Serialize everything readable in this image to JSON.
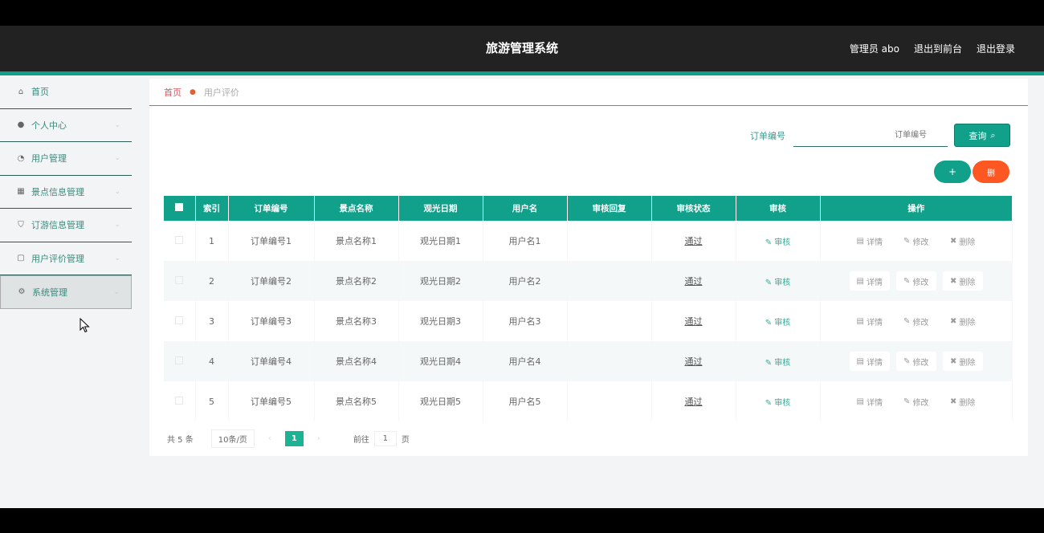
{
  "header": {
    "title": "旅游管理系统",
    "admin": "管理员 abo",
    "to_front": "退出到前台",
    "logout": "退出登录"
  },
  "sidebar": {
    "items": [
      {
        "label": "首页",
        "icon": "home-icon"
      },
      {
        "label": "个人中心",
        "icon": "user-icon"
      },
      {
        "label": "用户管理",
        "icon": "users-icon"
      },
      {
        "label": "景点信息管理",
        "icon": "image-icon"
      },
      {
        "label": "订游信息管理",
        "icon": "shield-icon"
      },
      {
        "label": "用户评价管理",
        "icon": "comment-icon"
      },
      {
        "label": "系统管理",
        "icon": "gear-icon"
      }
    ]
  },
  "breadcrumb": {
    "home": "首页",
    "current": "用户评价"
  },
  "search": {
    "label": "订单编号",
    "placeholder": "订单编号",
    "button": "查询"
  },
  "toolbar": {
    "add": "+",
    "delete": "删"
  },
  "table": {
    "columns": [
      "索引",
      "订单编号",
      "景点名称",
      "观光日期",
      "用户名",
      "审核回复",
      "审核状态",
      "审核",
      "操作"
    ],
    "rows": [
      {
        "index": "1",
        "order": "订单编号1",
        "spot": "景点名称1",
        "date": "观光日期1",
        "user": "用户名1",
        "reply": "",
        "status": "通过",
        "review": "审核"
      },
      {
        "index": "2",
        "order": "订单编号2",
        "spot": "景点名称2",
        "date": "观光日期2",
        "user": "用户名2",
        "reply": "",
        "status": "通过",
        "review": "审核"
      },
      {
        "index": "3",
        "order": "订单编号3",
        "spot": "景点名称3",
        "date": "观光日期3",
        "user": "用户名3",
        "reply": "",
        "status": "通过",
        "review": "审核"
      },
      {
        "index": "4",
        "order": "订单编号4",
        "spot": "景点名称4",
        "date": "观光日期4",
        "user": "用户名4",
        "reply": "",
        "status": "通过",
        "review": "审核"
      },
      {
        "index": "5",
        "order": "订单编号5",
        "spot": "景点名称5",
        "date": "观光日期5",
        "user": "用户名5",
        "reply": "",
        "status": "通过",
        "review": "审核"
      }
    ],
    "actions": {
      "detail": "详情",
      "edit": "修改",
      "delete": "删除"
    }
  },
  "pager": {
    "total": "共 5 条",
    "page_size": "10条/页",
    "current": "1",
    "goto_prefix": "前往",
    "goto_value": "1",
    "goto_suffix": "页"
  }
}
